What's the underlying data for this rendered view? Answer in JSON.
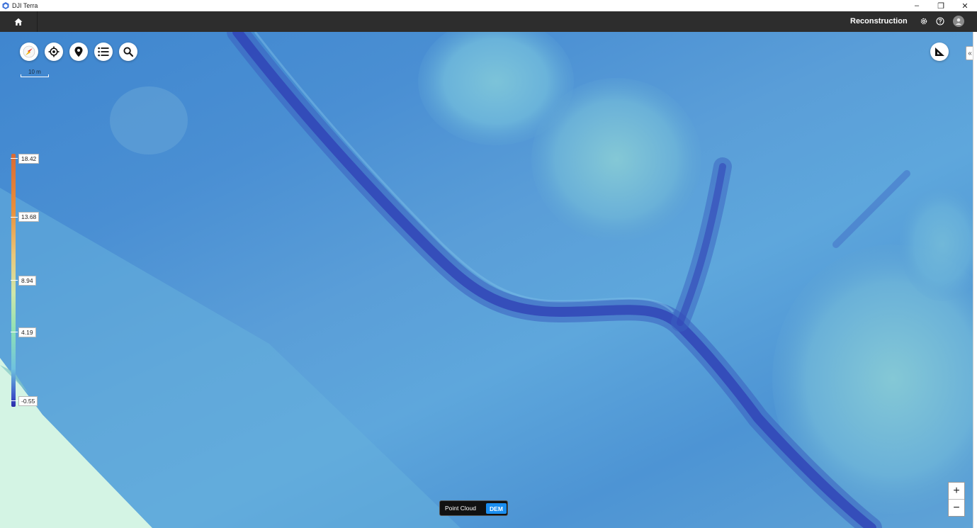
{
  "window": {
    "title": "DJI Terra",
    "controls": [
      "–",
      "❐",
      "✕"
    ]
  },
  "nav": {
    "home_icon": "home-icon",
    "page_title": "Reconstruction",
    "icons": [
      "gear-icon",
      "help-icon",
      "user-icon"
    ]
  },
  "map": {
    "toolbar": [
      "compass-icon",
      "locate-icon",
      "pin-icon",
      "list-icon",
      "search-icon"
    ],
    "measure_icon": "measure-icon",
    "scale_label": "10 m",
    "legend": {
      "labels": [
        "18.42",
        "13.68",
        "8.94",
        "4.19",
        "-0.55"
      ],
      "colors": [
        "#d86a35",
        "#e98f3a",
        "#e9c67a",
        "#8ee0b5",
        "#2b2ba8"
      ]
    },
    "toggle": {
      "point_cloud": "Point Cloud",
      "dem": "DEM",
      "active": "DEM",
      "accent": "#1a8ef0"
    },
    "zoom": {
      "in": "+",
      "out": "−"
    },
    "collapse_label": "«"
  }
}
